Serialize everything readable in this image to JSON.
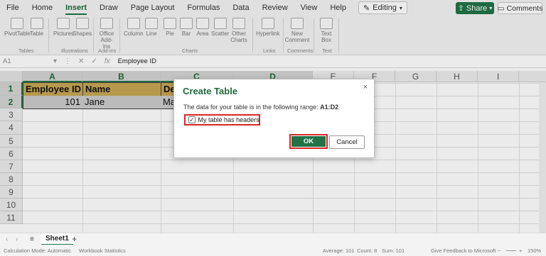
{
  "menu": {
    "items": [
      "File",
      "Home",
      "Insert",
      "Draw",
      "Page Layout",
      "Formulas",
      "Data",
      "Review",
      "View",
      "Help"
    ],
    "active": "Insert",
    "editing_label": "Editing",
    "share_label": "Share",
    "comments_label": "Comments"
  },
  "ribbon": {
    "groups": [
      {
        "label": "Tables",
        "buttons": [
          "PivotTable",
          "Table"
        ]
      },
      {
        "label": "Illustrations",
        "buttons": [
          "Pictures",
          "Shapes"
        ]
      },
      {
        "label": "Add-ins",
        "buttons": [
          "Office Add-ins"
        ]
      },
      {
        "label": "Charts",
        "buttons": [
          "Column",
          "Line",
          "Pie",
          "Bar",
          "Area",
          "Scatter",
          "Other Charts"
        ]
      },
      {
        "label": "Links",
        "buttons": [
          "Hyperlink"
        ]
      },
      {
        "label": "Comments",
        "buttons": [
          "New Comment"
        ]
      },
      {
        "label": "Text",
        "buttons": [
          "Text Box"
        ]
      }
    ]
  },
  "formula_bar": {
    "name_box": "A1",
    "fx": "fx",
    "value": "Employee ID"
  },
  "grid": {
    "columns": [
      "A",
      "B",
      "C",
      "D",
      "E",
      "F",
      "G",
      "H",
      "I"
    ],
    "rows": [
      "1",
      "2",
      "3",
      "4",
      "5",
      "6",
      "7",
      "8",
      "9",
      "10",
      "11"
    ],
    "cells": {
      "A1": "Employee ID",
      "B1": "Name",
      "C1": "De",
      "A2": "101",
      "B2": "Jane",
      "C2": "Ma"
    }
  },
  "dialog": {
    "title": "Create Table",
    "close": "×",
    "desc_prefix": "The data for your table is in the following range: ",
    "range": "A1:D2",
    "headers_label": "My table has headers",
    "headers_checked": true,
    "ok_label": "OK",
    "cancel_label": "Cancel"
  },
  "sheets": {
    "tabs": [
      "Sheet1"
    ],
    "add": "+"
  },
  "status": {
    "calc_mode": "Calculation Mode: Automatic",
    "workbook_stats": "Workbook Statistics",
    "average": "Average: 101",
    "count": "Count: 8",
    "sum": "Sum: 101",
    "feedback": "Give Feedback to Microsoft",
    "zoom": "150%"
  },
  "colors": {
    "accent": "#217346",
    "header_fill": "#c6a653",
    "highlight": "#d9262b"
  }
}
